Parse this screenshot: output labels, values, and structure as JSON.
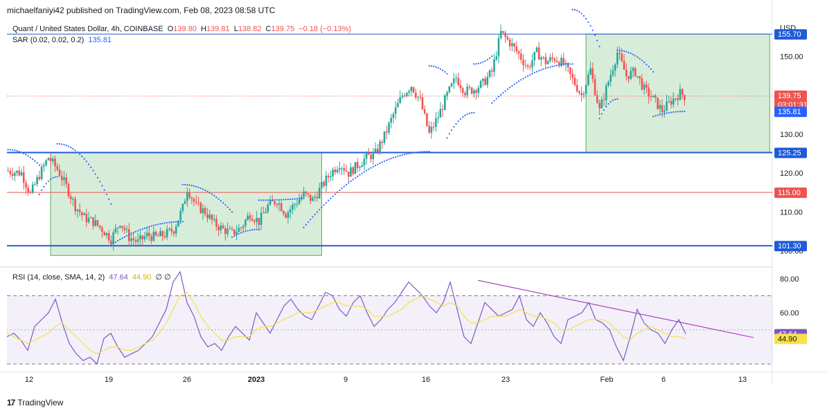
{
  "header": {
    "published": "michaelfaniyi42 published on TradingView.com, Feb 08, 2023 08:58 UTC"
  },
  "legend": {
    "symbol": "Quant / United States Dollar, 4h, COINBASE",
    "o_label": "O",
    "o": "139.80",
    "h_label": "H",
    "h": "139.81",
    "l_label": "L",
    "l": "138.82",
    "c_label": "C",
    "c": "139.75",
    "chg": "−0.18 (−0.13%)",
    "sar_label": "SAR (0.02, 0.02, 0.2)",
    "sar_value": "135.81",
    "rsi_label": "RSI (14, close, SMA, 14, 2)",
    "rsi_value": "47.64",
    "rsi_sma": "44.90",
    "rsi_extra": "∅ ∅"
  },
  "watermark": {
    "text": "TradingView",
    "logo": "17"
  },
  "colors": {
    "up": "#26a69a",
    "down": "#ef5350",
    "blue": "#2962ff",
    "hline": "#1e5bd8",
    "red_line": "#ef5350",
    "box_fill": "#c8e6c9",
    "box_stroke": "#4caf50",
    "sar": "#2962ff",
    "rsi_line": "#7e57c2",
    "rsi_sma": "#f7e04b",
    "trend": "#ab47bc",
    "price_label": "#ef5350"
  },
  "chart_data": [
    {
      "type": "candlestick",
      "title": "Quant / United States Dollar, 4h, COINBASE",
      "currency": "USD",
      "ylim": [
        96,
        160
      ],
      "y_ticks": [
        100,
        110,
        120,
        130,
        150
      ],
      "x_ticks": [
        "12",
        "19",
        "26",
        "2023",
        "9",
        "16",
        "23",
        "Feb",
        "6",
        "13"
      ],
      "price_marks": [
        {
          "label": "155.70",
          "value": 155.7,
          "style": "blue-line"
        },
        {
          "label": "125.25",
          "value": 125.25,
          "style": "blue-line"
        },
        {
          "label": "115.00",
          "value": 115.0,
          "style": "red-line"
        },
        {
          "label": "101.30",
          "value": 101.3,
          "style": "blue-line"
        },
        {
          "label": "139.75",
          "sublabel": "03:01:31",
          "value": 139.75,
          "style": "last-price"
        },
        {
          "label": "135.81",
          "value": 135.81,
          "style": "sar"
        }
      ],
      "y_tick_labels": [
        "100.00",
        "110.00",
        "120.00",
        "130.00",
        "150.00"
      ],
      "close_path": [
        [
          0,
          120.5
        ],
        [
          6,
          120.0
        ],
        [
          10,
          114.5
        ],
        [
          14,
          119.5
        ],
        [
          18,
          124.0
        ],
        [
          22,
          121.0
        ],
        [
          26,
          116.5
        ],
        [
          30,
          111.5
        ],
        [
          34,
          108.5
        ],
        [
          38,
          107.5
        ],
        [
          42,
          105.5
        ],
        [
          46,
          103.0
        ],
        [
          50,
          107.5
        ],
        [
          54,
          103.5
        ],
        [
          58,
          102.2
        ],
        [
          62,
          104.0
        ],
        [
          66,
          103.5
        ],
        [
          70,
          104.2
        ],
        [
          74,
          105.5
        ],
        [
          78,
          111.0
        ],
        [
          80,
          116.0
        ],
        [
          84,
          111.5
        ],
        [
          88,
          110.0
        ],
        [
          92,
          107.0
        ],
        [
          96,
          105.5
        ],
        [
          100,
          104.5
        ],
        [
          104,
          106.0
        ],
        [
          108,
          109.5
        ],
        [
          112,
          107.5
        ],
        [
          116,
          111.5
        ],
        [
          120,
          113.0
        ],
        [
          124,
          109.5
        ],
        [
          128,
          112.0
        ],
        [
          132,
          114.5
        ],
        [
          136,
          113.0
        ],
        [
          140,
          116.5
        ],
        [
          144,
          120.0
        ],
        [
          148,
          122.5
        ],
        [
          152,
          120.0
        ],
        [
          156,
          122.0
        ],
        [
          160,
          124.0
        ],
        [
          164,
          125.0
        ],
        [
          168,
          129.5
        ],
        [
          172,
          135.0
        ],
        [
          176,
          140.0
        ],
        [
          180,
          142.5
        ],
        [
          184,
          138.5
        ],
        [
          188,
          130.0
        ],
        [
          192,
          134.5
        ],
        [
          196,
          140.0
        ],
        [
          200,
          144.5
        ],
        [
          204,
          141.0
        ],
        [
          208,
          141.5
        ],
        [
          212,
          143.0
        ],
        [
          216,
          146.0
        ],
        [
          220,
          156.0
        ],
        [
          224,
          153.5
        ],
        [
          228,
          150.5
        ],
        [
          232,
          147.0
        ],
        [
          236,
          151.0
        ],
        [
          240,
          148.5
        ],
        [
          244,
          149.5
        ],
        [
          248,
          148.0
        ],
        [
          252,
          144.0
        ],
        [
          256,
          140.0
        ],
        [
          260,
          146.5
        ],
        [
          264,
          136.0
        ],
        [
          268,
          143.5
        ],
        [
          272,
          151.0
        ],
        [
          276,
          145.0
        ],
        [
          280,
          146.0
        ],
        [
          284,
          141.5
        ],
        [
          288,
          139.0
        ],
        [
          292,
          136.0
        ],
        [
          296,
          138.5
        ],
        [
          300,
          140.5
        ],
        [
          302,
          139.75
        ]
      ],
      "n_bars": 303,
      "sar_segments": [
        {
          "from": 0,
          "to": 14,
          "start": 126.0,
          "end": 122.0,
          "side": "above"
        },
        {
          "from": 14,
          "to": 22,
          "start": 114.5,
          "end": 119.0,
          "side": "below"
        },
        {
          "from": 22,
          "to": 46,
          "start": 127.5,
          "end": 112.0,
          "side": "above"
        },
        {
          "from": 46,
          "to": 78,
          "start": 101.5,
          "end": 107.5,
          "side": "below"
        },
        {
          "from": 78,
          "to": 100,
          "start": 117.0,
          "end": 110.0,
          "side": "above"
        },
        {
          "from": 100,
          "to": 112,
          "start": 103.5,
          "end": 105.5,
          "side": "below"
        },
        {
          "from": 112,
          "to": 132,
          "start": 113.0,
          "end": 113.5,
          "side": "above"
        },
        {
          "from": 132,
          "to": 188,
          "start": 106.0,
          "end": 125.5,
          "side": "below"
        },
        {
          "from": 188,
          "to": 196,
          "start": 147.5,
          "end": 145.5,
          "side": "above"
        },
        {
          "from": 196,
          "to": 208,
          "start": 129.0,
          "end": 135.5,
          "side": "below"
        },
        {
          "from": 208,
          "to": 216,
          "start": 148.0,
          "end": 150.0,
          "side": "above"
        },
        {
          "from": 216,
          "to": 252,
          "start": 138.0,
          "end": 148.0,
          "side": "below"
        },
        {
          "from": 252,
          "to": 264,
          "start": 162.0,
          "end": 152.5,
          "side": "above"
        },
        {
          "from": 264,
          "to": 272,
          "start": 134.0,
          "end": 139.0,
          "side": "below"
        },
        {
          "from": 272,
          "to": 288,
          "start": 151.5,
          "end": 146.0,
          "side": "above"
        },
        {
          "from": 288,
          "to": 302,
          "start": 134.5,
          "end": 135.81,
          "side": "below"
        }
      ],
      "boxes": [
        {
          "from_bar": 19,
          "to_bar": 140,
          "top": 125.25,
          "bottom": 98.8
        },
        {
          "from_bar": 258,
          "to_bar": 340,
          "top": 155.7,
          "bottom": 125.25
        }
      ]
    },
    {
      "type": "line",
      "title": "RSI (14, close, SMA, 14, 2)",
      "ylim": [
        26,
        86
      ],
      "y_ticks": [
        80,
        60
      ],
      "y_tick_labels": [
        "80.00",
        "60.00"
      ],
      "band": [
        70,
        30
      ],
      "midline": 50,
      "series": [
        {
          "name": "RSI",
          "values": [
            46,
            48,
            44,
            38,
            52,
            56,
            60,
            68,
            54,
            42,
            36,
            32,
            34,
            30,
            45,
            48,
            40,
            34,
            36,
            38,
            42,
            46,
            54,
            62,
            78,
            84,
            66,
            58,
            46,
            40,
            42,
            38,
            46,
            52,
            48,
            44,
            60,
            54,
            48,
            56,
            64,
            68,
            62,
            58,
            56,
            64,
            72,
            70,
            62,
            58,
            66,
            70,
            60,
            52,
            56,
            62,
            66,
            72,
            78,
            74,
            70,
            64,
            60,
            66,
            78,
            62,
            46,
            42,
            54,
            66,
            62,
            58,
            60,
            62,
            70,
            56,
            52,
            60,
            54,
            46,
            42,
            56,
            58,
            60,
            66,
            56,
            54,
            50,
            40,
            32,
            46,
            62,
            54,
            50,
            48,
            42,
            50,
            56,
            47.64
          ]
        },
        {
          "name": "SMA",
          "values": [
            48,
            46,
            44,
            42,
            44,
            46,
            48,
            52,
            54,
            50,
            46,
            42,
            38,
            36,
            38,
            40,
            40,
            38,
            38,
            40,
            42,
            44,
            48,
            54,
            62,
            70,
            72,
            66,
            58,
            52,
            48,
            44,
            44,
            46,
            46,
            46,
            50,
            52,
            52,
            54,
            56,
            58,
            60,
            60,
            60,
            62,
            64,
            66,
            66,
            64,
            64,
            64,
            62,
            58,
            58,
            58,
            60,
            62,
            66,
            68,
            70,
            68,
            66,
            64,
            66,
            64,
            58,
            54,
            54,
            56,
            58,
            58,
            58,
            60,
            62,
            60,
            58,
            58,
            56,
            54,
            50,
            50,
            52,
            54,
            56,
            56,
            56,
            54,
            50,
            46,
            44,
            48,
            50,
            52,
            50,
            48,
            46,
            46,
            44.9
          ]
        }
      ],
      "trendline": {
        "from_index": 68,
        "from_value": 79,
        "to_index": 98,
        "to_value": 45.5
      }
    }
  ]
}
